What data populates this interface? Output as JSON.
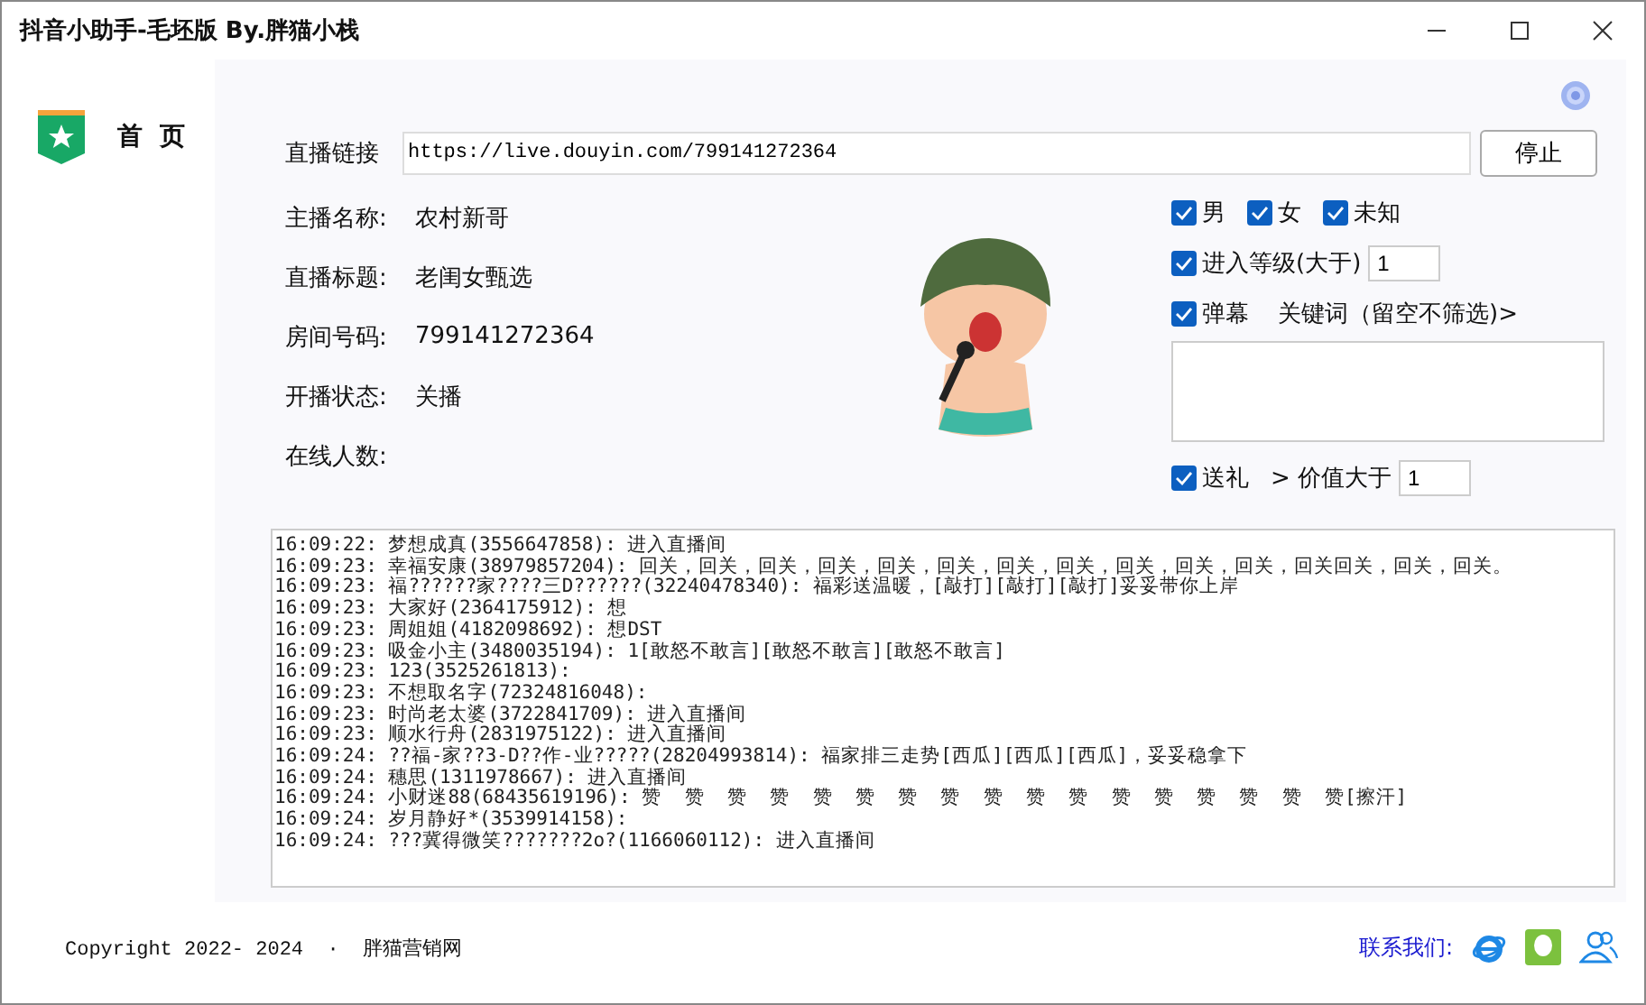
{
  "window": {
    "title": "抖音小助手-毛坯版  By.胖猫小栈"
  },
  "sidebar": {
    "items": [
      {
        "label": "首  页",
        "selected": true
      }
    ]
  },
  "link": {
    "label": "直播链接",
    "value": "https://live.douyin.com/799141272364",
    "button": "停止"
  },
  "info": [
    {
      "label": "主播名称:",
      "value": "农村新哥"
    },
    {
      "label": "直播标题:",
      "value": "老闺女甄选"
    },
    {
      "label": "房间号码:",
      "value": "799141272364"
    },
    {
      "label": "开播状态:",
      "value": "关播"
    },
    {
      "label": "在线人数:"
    }
  ],
  "filters": {
    "genders": [
      {
        "label": "男",
        "checked": true
      },
      {
        "label": "女",
        "checked": true
      },
      {
        "label": "未知",
        "checked": true
      }
    ],
    "level": {
      "label": "进入等级(大于)",
      "checked": true,
      "value": "1"
    },
    "danmaku": {
      "label": "弹幕",
      "checked": true,
      "hint": "关键词（留空不筛选)>"
    },
    "gift": {
      "label": "送礼",
      "checked": true,
      "hint": "> 价值大于",
      "value": "1"
    }
  },
  "log": [
    "16:09:22: 梦想成真(3556647858): 进入直播间",
    "16:09:23: 幸福安康(38979857204): 回关，回关，回关，回关，回关，回关，回关，回关，回关，回关，回关，回关回关，回关，回关。",
    "16:09:23: 福??????家????三D??????(32240478340): 福彩送温暖，[敲打][敲打][敲打]妥妥带你上岸",
    "16:09:23: 大家好(2364175912): 想",
    "16:09:23: 周姐姐(4182098692): 想DST",
    "16:09:23: 吸金小主(3480035194): 1[敢怒不敢言][敢怒不敢言][敢怒不敢言]",
    "16:09:23: 123(3525261813):",
    "16:09:23: 不想取名字(72324816048):",
    "16:09:23: 时尚老太婆(3722841709): 进入直播间",
    "16:09:23: 顺水行舟(2831975122): 进入直播间",
    "16:09:24: ??福-家??3-D??作-业?????(28204993814): 福家排三走势[西瓜][西瓜][西瓜]，妥妥稳拿下",
    "16:09:24: 穗思(1311978667): 进入直播间",
    "16:09:24: 小财迷88(68435619196): 赞  赞  赞  赞  赞  赞  赞  赞  赞  赞  赞  赞  赞  赞  赞  赞  赞[擦汗]",
    "16:09:24: 岁月静好*(3539914158):",
    "16:09:24: ???冀得微笑???????2o?(1166060112): 进入直播间"
  ],
  "footer": {
    "copyright": "Copyright 2022- 2024  ·  胖猫营销网",
    "contact": "联系我们:"
  }
}
